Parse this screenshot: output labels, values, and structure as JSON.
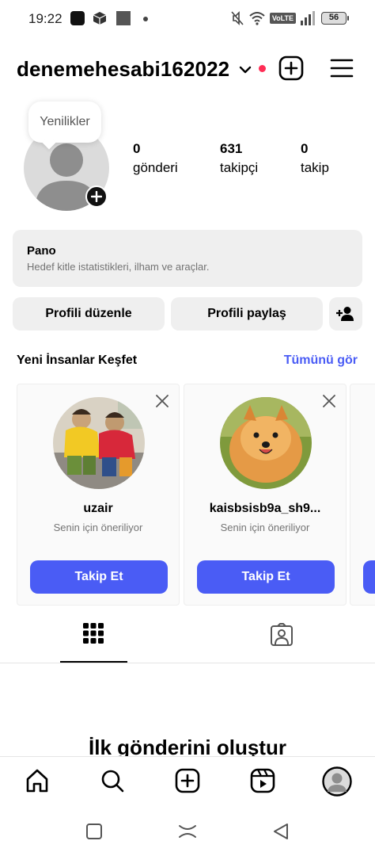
{
  "status": {
    "time": "19:22",
    "network": "VoLTE",
    "battery": "56"
  },
  "header": {
    "username": "denemehesabi162022"
  },
  "profile": {
    "tooltip": "Yenilikler",
    "stats": [
      {
        "value": "0",
        "label": "gönderi"
      },
      {
        "value": "631",
        "label": "takipçi"
      },
      {
        "value": "0",
        "label": "takip"
      }
    ]
  },
  "dashboard": {
    "title": "Pano",
    "subtitle": "Hedef kitle istatistikleri, ilham ve araçlar."
  },
  "actions": {
    "edit_profile": "Profili düzenle",
    "share_profile": "Profili paylaş"
  },
  "discover": {
    "title": "Yeni İnsanlar Keşfet",
    "see_all": "Tümünü gör",
    "cards": [
      {
        "name": "uzair",
        "subtitle": "Senin için öneriliyor",
        "button": "Takip Et"
      },
      {
        "name": "kaisbsisb9a_sh9...",
        "subtitle": "Senin için öneriliyor",
        "button": "Takip Et"
      }
    ]
  },
  "content": {
    "empty_title": "İlk gönderini oluştur"
  },
  "colors": {
    "accent": "#4a5cf5",
    "notification": "#ff2d55",
    "surface": "#efefef"
  }
}
